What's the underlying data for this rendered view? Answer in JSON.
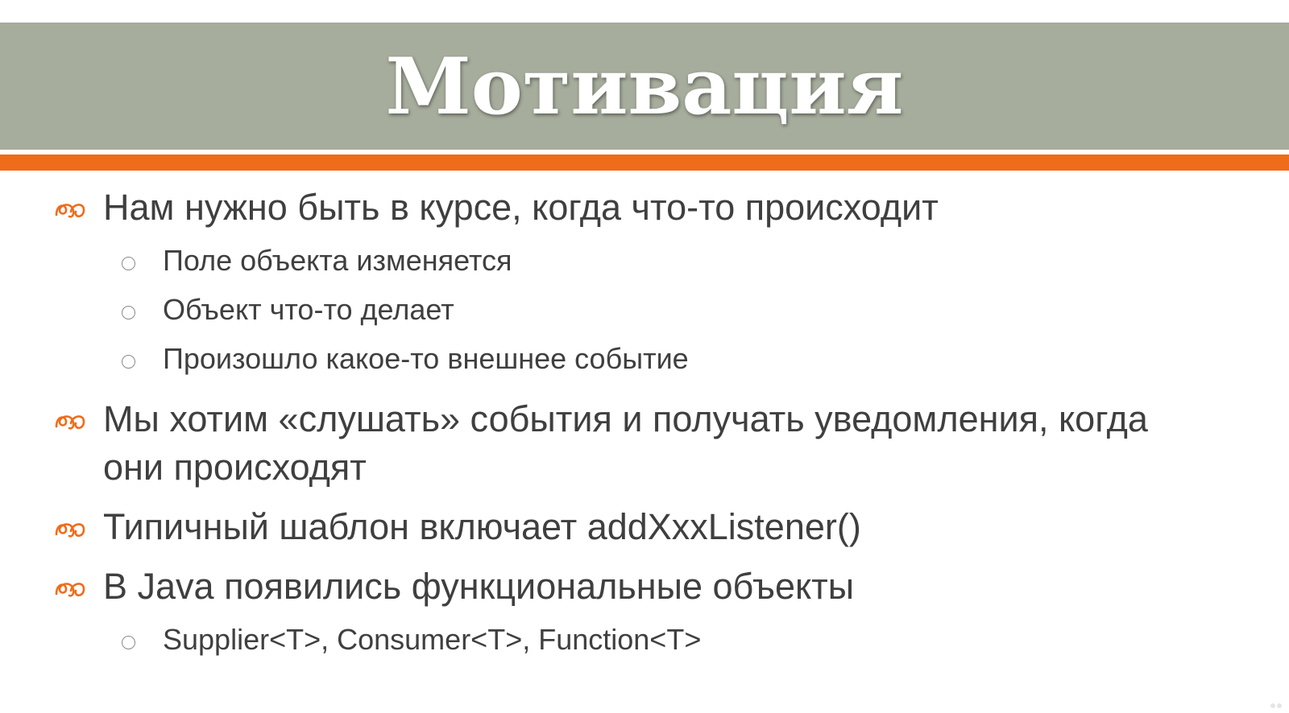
{
  "slide": {
    "title": "Мотивация",
    "colors": {
      "title_bar": "#a6ad9c",
      "accent_bar": "#ef6c1a",
      "title_text": "#ffffff",
      "body_text": "#3f3f3f",
      "bullet_marker": "#ef6c1a"
    },
    "bullets": [
      {
        "text": "Нам нужно быть в курсе, когда что-то происходит",
        "marker_icon": "orange-swirl-bullet-icon",
        "sub": [
          "Поле объекта изменяется",
          "Объект что-то делает",
          "Произошло какое-то внешнее событие"
        ]
      },
      {
        "text": "Мы хотим «слушать» события и получать уведомления, когда они происходят",
        "marker_icon": "orange-swirl-bullet-icon",
        "sub": []
      },
      {
        "text": "Типичный шаблон включает addXxxListener()",
        "marker_icon": "orange-swirl-bullet-icon",
        "sub": []
      },
      {
        "text": "В Java появились функциональные объекты",
        "marker_icon": "orange-swirl-bullet-icon",
        "sub": [
          "Supplier<T>, Consumer<T>, Function<T>"
        ]
      }
    ],
    "sub_marker_icon": "hollow-circle-bullet-icon"
  }
}
